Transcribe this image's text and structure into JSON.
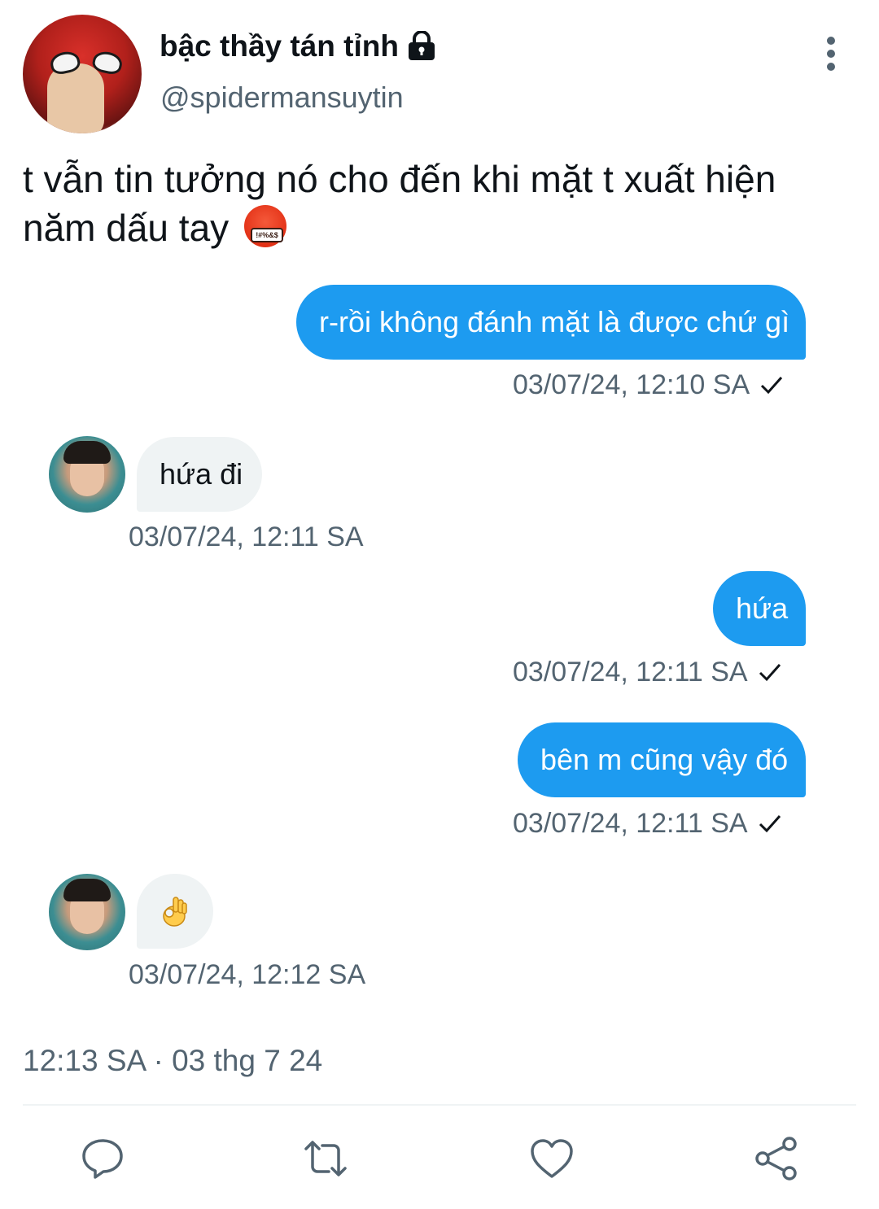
{
  "header": {
    "display_name": "bậc thầy tán tỉnh",
    "handle": "@spidermansuytin",
    "icons": [
      "lock-icon",
      "more-vertical-icon"
    ]
  },
  "tweet": {
    "text_line1": "t vẫn tin tưởng nó cho đến khi mặt t xuất hiện",
    "text_line2": "năm dấu tay",
    "emoji_label": "!#%&$",
    "time": "12:13 SA · 03 thg 7 24"
  },
  "messages": [
    {
      "side": "right",
      "text": "r-rồi không đánh mặt là được chứ gì",
      "time": "03/07/24, 12:10 SA"
    },
    {
      "side": "left",
      "text": "hứa đi",
      "time": "03/07/24, 12:11 SA"
    },
    {
      "side": "right",
      "text": "hứa",
      "time": "03/07/24, 12:11 SA"
    },
    {
      "side": "right",
      "text": "bên m cũng vậy đó",
      "time": "03/07/24, 12:11 SA"
    },
    {
      "side": "left",
      "text": "👌",
      "time": "03/07/24, 12:12 SA"
    }
  ],
  "actions": [
    "reply-icon",
    "retweet-icon",
    "like-icon",
    "share-icon"
  ],
  "colors": {
    "accent": "#1d9bf0",
    "bubble_gray": "#eff3f4",
    "secondary_text": "#536471"
  }
}
